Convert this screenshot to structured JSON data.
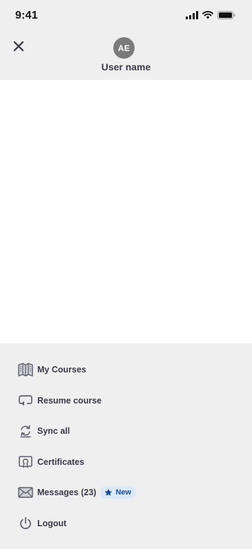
{
  "status_bar": {
    "time": "9:41"
  },
  "header": {
    "avatar_initials": "AE",
    "user_name": "User name"
  },
  "menu": {
    "items": [
      {
        "label": "My Courses",
        "icon": "book-open-icon"
      },
      {
        "label": "Resume course",
        "icon": "resume-icon"
      },
      {
        "label": "Sync all",
        "icon": "sync-icon"
      },
      {
        "label": "Certificates",
        "icon": "certificate-icon"
      },
      {
        "label": "Messages (23)",
        "icon": "envelope-icon",
        "badge": {
          "label": "New",
          "icon": "star-icon"
        }
      },
      {
        "label": "Logout",
        "icon": "power-icon"
      }
    ]
  },
  "colors": {
    "header_background": "#efefef",
    "menu_background": "#efefef",
    "avatar_background": "#7b7b7b",
    "badge_background": "#dbe9f7",
    "badge_text": "#1b4f8f"
  }
}
